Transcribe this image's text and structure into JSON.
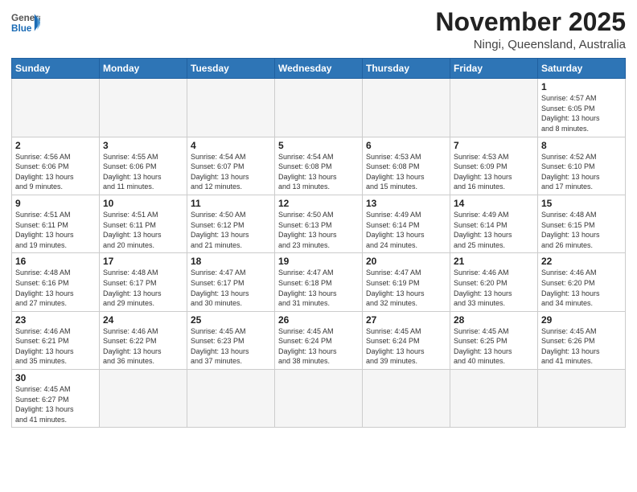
{
  "logo": {
    "line1": "General",
    "line2": "Blue"
  },
  "title": "November 2025",
  "subtitle": "Ningi, Queensland, Australia",
  "weekdays": [
    "Sunday",
    "Monday",
    "Tuesday",
    "Wednesday",
    "Thursday",
    "Friday",
    "Saturday"
  ],
  "days": [
    {
      "num": "",
      "info": ""
    },
    {
      "num": "",
      "info": ""
    },
    {
      "num": "",
      "info": ""
    },
    {
      "num": "",
      "info": ""
    },
    {
      "num": "",
      "info": ""
    },
    {
      "num": "",
      "info": ""
    },
    {
      "num": "1",
      "info": "Sunrise: 4:57 AM\nSunset: 6:05 PM\nDaylight: 13 hours\nand 8 minutes."
    },
    {
      "num": "2",
      "info": "Sunrise: 4:56 AM\nSunset: 6:06 PM\nDaylight: 13 hours\nand 9 minutes."
    },
    {
      "num": "3",
      "info": "Sunrise: 4:55 AM\nSunset: 6:06 PM\nDaylight: 13 hours\nand 11 minutes."
    },
    {
      "num": "4",
      "info": "Sunrise: 4:54 AM\nSunset: 6:07 PM\nDaylight: 13 hours\nand 12 minutes."
    },
    {
      "num": "5",
      "info": "Sunrise: 4:54 AM\nSunset: 6:08 PM\nDaylight: 13 hours\nand 13 minutes."
    },
    {
      "num": "6",
      "info": "Sunrise: 4:53 AM\nSunset: 6:08 PM\nDaylight: 13 hours\nand 15 minutes."
    },
    {
      "num": "7",
      "info": "Sunrise: 4:53 AM\nSunset: 6:09 PM\nDaylight: 13 hours\nand 16 minutes."
    },
    {
      "num": "8",
      "info": "Sunrise: 4:52 AM\nSunset: 6:10 PM\nDaylight: 13 hours\nand 17 minutes."
    },
    {
      "num": "9",
      "info": "Sunrise: 4:51 AM\nSunset: 6:11 PM\nDaylight: 13 hours\nand 19 minutes."
    },
    {
      "num": "10",
      "info": "Sunrise: 4:51 AM\nSunset: 6:11 PM\nDaylight: 13 hours\nand 20 minutes."
    },
    {
      "num": "11",
      "info": "Sunrise: 4:50 AM\nSunset: 6:12 PM\nDaylight: 13 hours\nand 21 minutes."
    },
    {
      "num": "12",
      "info": "Sunrise: 4:50 AM\nSunset: 6:13 PM\nDaylight: 13 hours\nand 23 minutes."
    },
    {
      "num": "13",
      "info": "Sunrise: 4:49 AM\nSunset: 6:14 PM\nDaylight: 13 hours\nand 24 minutes."
    },
    {
      "num": "14",
      "info": "Sunrise: 4:49 AM\nSunset: 6:14 PM\nDaylight: 13 hours\nand 25 minutes."
    },
    {
      "num": "15",
      "info": "Sunrise: 4:48 AM\nSunset: 6:15 PM\nDaylight: 13 hours\nand 26 minutes."
    },
    {
      "num": "16",
      "info": "Sunrise: 4:48 AM\nSunset: 6:16 PM\nDaylight: 13 hours\nand 27 minutes."
    },
    {
      "num": "17",
      "info": "Sunrise: 4:48 AM\nSunset: 6:17 PM\nDaylight: 13 hours\nand 29 minutes."
    },
    {
      "num": "18",
      "info": "Sunrise: 4:47 AM\nSunset: 6:17 PM\nDaylight: 13 hours\nand 30 minutes."
    },
    {
      "num": "19",
      "info": "Sunrise: 4:47 AM\nSunset: 6:18 PM\nDaylight: 13 hours\nand 31 minutes."
    },
    {
      "num": "20",
      "info": "Sunrise: 4:47 AM\nSunset: 6:19 PM\nDaylight: 13 hours\nand 32 minutes."
    },
    {
      "num": "21",
      "info": "Sunrise: 4:46 AM\nSunset: 6:20 PM\nDaylight: 13 hours\nand 33 minutes."
    },
    {
      "num": "22",
      "info": "Sunrise: 4:46 AM\nSunset: 6:20 PM\nDaylight: 13 hours\nand 34 minutes."
    },
    {
      "num": "23",
      "info": "Sunrise: 4:46 AM\nSunset: 6:21 PM\nDaylight: 13 hours\nand 35 minutes."
    },
    {
      "num": "24",
      "info": "Sunrise: 4:46 AM\nSunset: 6:22 PM\nDaylight: 13 hours\nand 36 minutes."
    },
    {
      "num": "25",
      "info": "Sunrise: 4:45 AM\nSunset: 6:23 PM\nDaylight: 13 hours\nand 37 minutes."
    },
    {
      "num": "26",
      "info": "Sunrise: 4:45 AM\nSunset: 6:24 PM\nDaylight: 13 hours\nand 38 minutes."
    },
    {
      "num": "27",
      "info": "Sunrise: 4:45 AM\nSunset: 6:24 PM\nDaylight: 13 hours\nand 39 minutes."
    },
    {
      "num": "28",
      "info": "Sunrise: 4:45 AM\nSunset: 6:25 PM\nDaylight: 13 hours\nand 40 minutes."
    },
    {
      "num": "29",
      "info": "Sunrise: 4:45 AM\nSunset: 6:26 PM\nDaylight: 13 hours\nand 41 minutes."
    },
    {
      "num": "30",
      "info": "Sunrise: 4:45 AM\nSunset: 6:27 PM\nDaylight: 13 hours\nand 41 minutes."
    },
    {
      "num": "",
      "info": ""
    },
    {
      "num": "",
      "info": ""
    },
    {
      "num": "",
      "info": ""
    },
    {
      "num": "",
      "info": ""
    },
    {
      "num": "",
      "info": ""
    },
    {
      "num": "",
      "info": ""
    }
  ]
}
